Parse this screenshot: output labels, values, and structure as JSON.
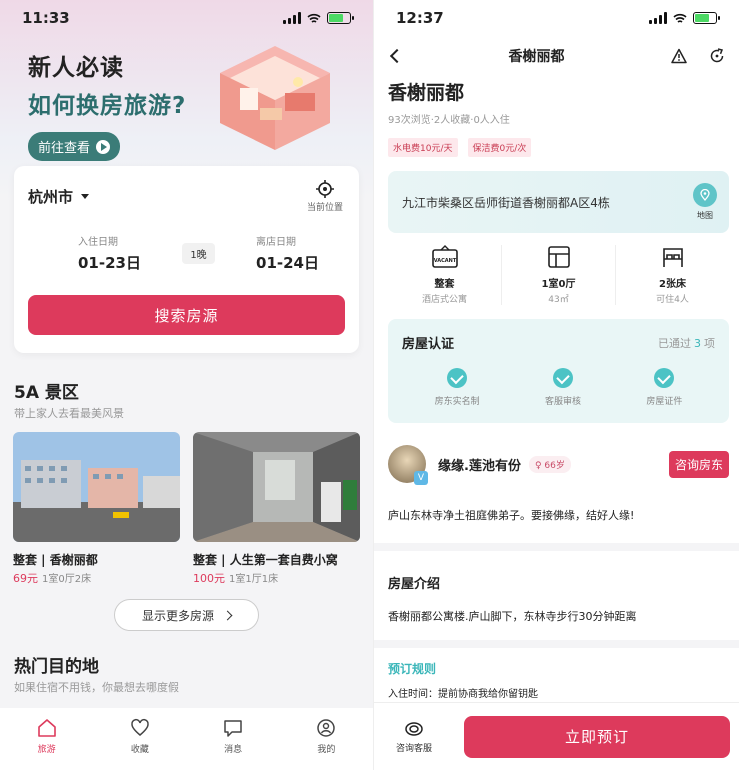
{
  "left": {
    "status": {
      "time": "11:33"
    },
    "banner": {
      "line1": "新人必读",
      "line2": "如何换房旅游?",
      "button": "前往查看"
    },
    "search": {
      "city": "杭州市",
      "location_label": "当前位置",
      "checkin_label": "入住日期",
      "checkin_value": "01-23日",
      "nights": "1晚",
      "checkout_label": "离店日期",
      "checkout_value": "01-24日",
      "button": "搜索房源"
    },
    "scenic": {
      "title": "5A 景区",
      "subtitle": "带上家人去看最美风景",
      "cards": [
        {
          "title": "整套 | 香榭丽都",
          "price": "69元",
          "meta": "1室0厅2床"
        },
        {
          "title": "整套 | 人生第一套自费小窝",
          "price": "100元",
          "meta": "1室1厅1床"
        }
      ],
      "more": "显示更多房源"
    },
    "hot": {
      "title": "热门目的地",
      "subtitle": "如果住宿不用钱，你最想去哪度假"
    },
    "tabs": [
      {
        "label": "旅游",
        "icon": "home-icon",
        "active": true
      },
      {
        "label": "收藏",
        "icon": "heart-icon",
        "active": false
      },
      {
        "label": "消息",
        "icon": "message-icon",
        "active": false
      },
      {
        "label": "我的",
        "icon": "profile-icon",
        "active": false
      }
    ]
  },
  "right": {
    "status": {
      "time": "12:37"
    },
    "nav_title": "香榭丽都",
    "title": "香榭丽都",
    "stats": "93次浏览·2人收藏·0人入住",
    "fees": [
      "水电费10元/天",
      "保洁费0元/次"
    ],
    "address": "九江市柴桑区岳师街道香榭丽都A区4栋",
    "map_label": "地图",
    "features": [
      {
        "title": "整套",
        "sub": "酒店式公寓",
        "icon": "vacant-sign-icon"
      },
      {
        "title": "1室0厅",
        "sub": "43㎡",
        "icon": "floorplan-icon"
      },
      {
        "title": "2张床",
        "sub": "可住4人",
        "icon": "bed-icon"
      }
    ],
    "cert": {
      "title": "房屋认证",
      "passed_prefix": "已通过",
      "passed_count": "3",
      "passed_suffix": "项",
      "items": [
        "房东实名制",
        "客服审核",
        "房屋证件"
      ]
    },
    "host": {
      "name": "缘缘.莲池有份",
      "age": "66岁",
      "consult": "咨询房东",
      "quote": "庐山东林寺净土祖庭佛弟子。要接佛缘，结好人缘!"
    },
    "intro": {
      "title": "房屋介绍",
      "text": "香榭丽都公寓楼.庐山脚下，东林寺步行30分钟距离"
    },
    "rules": {
      "title": "预订规则",
      "text": "入住时间：提前协商我给你留钥匙"
    },
    "bottom": {
      "service": "咨询客服",
      "book": "立即预订"
    }
  },
  "colors": {
    "accent": "#dd3a5c",
    "teal": "#3ab6b9"
  }
}
